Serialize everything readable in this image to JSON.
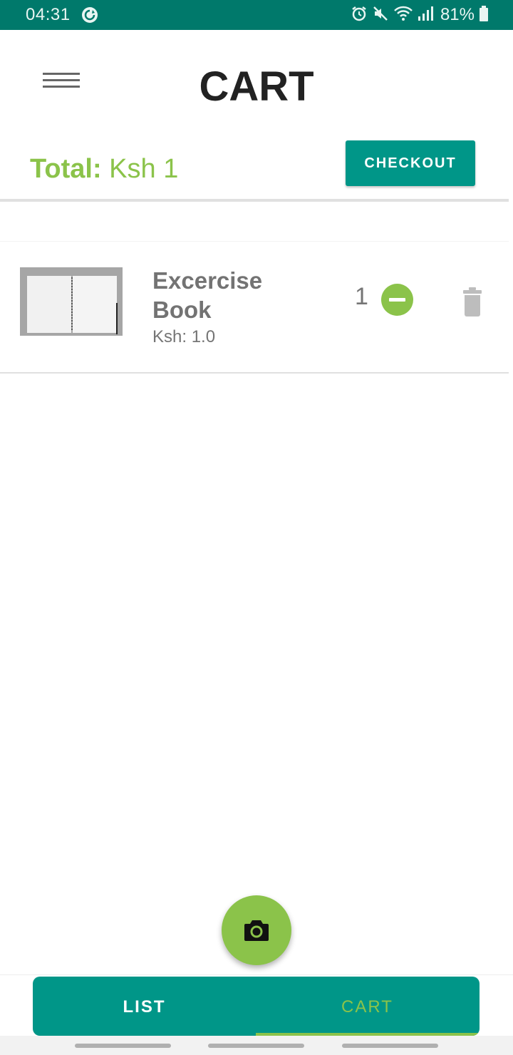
{
  "status_bar": {
    "time": "04:31",
    "battery": "81%",
    "background": "#00796b"
  },
  "header": {
    "title": "CART",
    "menu_icon": "hamburger-menu-icon"
  },
  "summary": {
    "total_label": "Total:",
    "total_value": "Ksh 1",
    "checkout_label": "CHECKOUT"
  },
  "cart": {
    "items": [
      {
        "name": "Excercise Book",
        "price": "Ksh: 1.0",
        "quantity": "1",
        "image_icon": "notebook-image"
      }
    ]
  },
  "fab": {
    "icon": "camera-icon"
  },
  "bottom_nav": {
    "tabs": [
      {
        "label": "LIST",
        "selected": false
      },
      {
        "label": "CART",
        "selected": true
      }
    ]
  },
  "colors": {
    "primary": "#009688",
    "accent": "#8bc34a",
    "text_dark": "#222222",
    "text_muted": "#757575"
  }
}
